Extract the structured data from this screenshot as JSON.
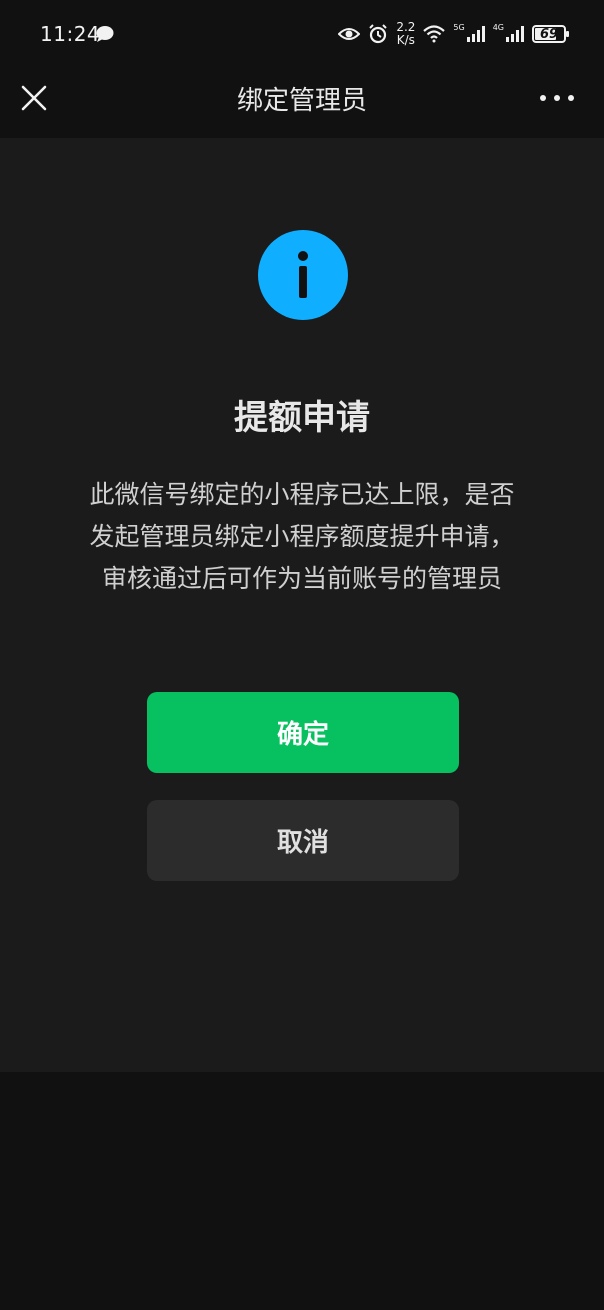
{
  "status_bar": {
    "time": "11:24",
    "speed_value": "2.2",
    "speed_unit": "K/s",
    "network_1": "5G",
    "network_2": "4G",
    "battery_level": "69",
    "icons": [
      "chat-bubble-icon",
      "eye-icon",
      "alarm-icon",
      "wifi-icon",
      "signal-icon",
      "battery-icon"
    ]
  },
  "nav": {
    "title": "绑定管理员",
    "close_icon": "close-icon",
    "more_icon": "more-icon"
  },
  "dialog": {
    "icon": "info-icon",
    "icon_color": "#10aeff",
    "title": "提额申请",
    "message_line_1": "此微信号绑定的小程序已达上限，是否",
    "message_line_2": "发起管理员绑定小程序额度提升申请，",
    "message_line_3": "审核通过后可作为当前账号的管理员",
    "confirm_label": "确定",
    "confirm_color": "#07c160",
    "cancel_label": "取消"
  }
}
